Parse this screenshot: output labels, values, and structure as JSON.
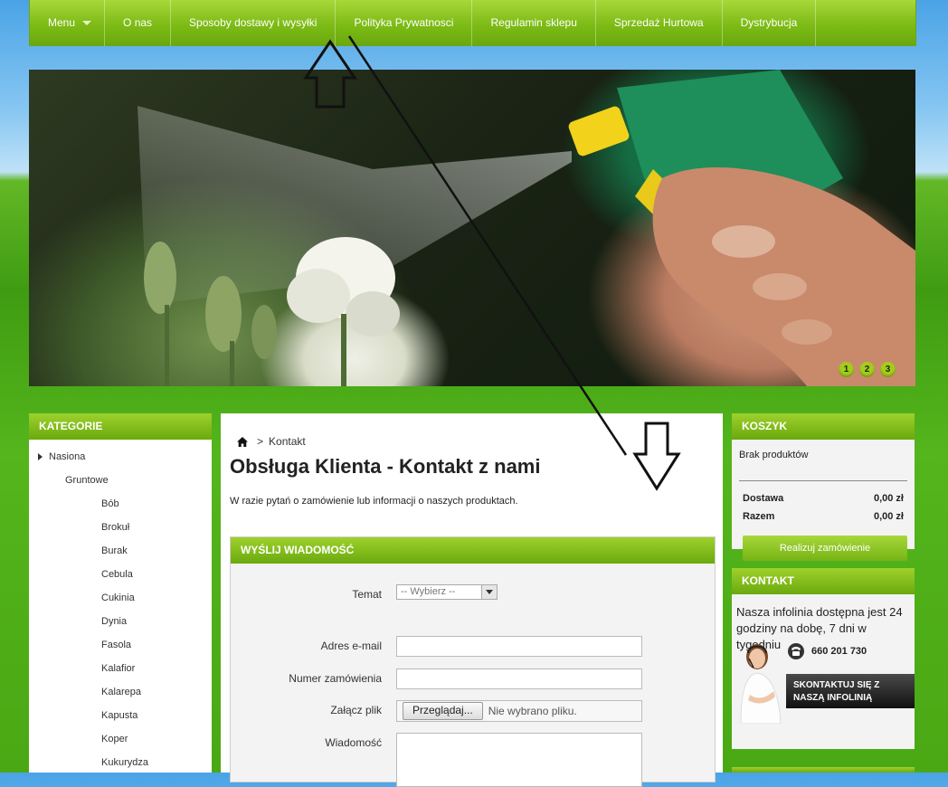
{
  "nav": {
    "items": [
      {
        "label": "Menu",
        "key": "menu"
      },
      {
        "label": "O nas",
        "key": "about"
      },
      {
        "label": "Sposoby dostawy i wysyłki",
        "key": "shipping"
      },
      {
        "label": "Polityka Prywatnosci",
        "key": "privacy"
      },
      {
        "label": "Regulamin sklepu",
        "key": "terms"
      },
      {
        "label": "Sprzedaż Hurtowa",
        "key": "wholesale"
      },
      {
        "label": "Dystrybucja",
        "key": "distribution"
      }
    ]
  },
  "banner": {
    "pages": [
      "1",
      "2",
      "3"
    ]
  },
  "categories": {
    "title": "KATEGORIE",
    "level1": "Nasiona",
    "level2": "Gruntowe",
    "items": [
      "Bób",
      "Brokuł",
      "Burak",
      "Cebula",
      "Cukinia",
      "Dynia",
      "Fasola",
      "Kalafior",
      "Kalarepa",
      "Kapusta",
      "Koper",
      "Kukurydza"
    ]
  },
  "breadcrumb": {
    "separator": ">",
    "current": "Kontakt"
  },
  "main": {
    "title": "Obsługa Klienta - Kontakt z nami",
    "intro": "W razie pytań o zamówienie lub informacji o naszych produktach."
  },
  "form": {
    "title": "WYŚLIJ WIADOMOŚĆ",
    "subject_label": "Temat",
    "subject_value": "-- Wybierz --",
    "email_label": "Adres e-mail",
    "order_label": "Numer zamówienia",
    "file_label": "Załącz plik",
    "file_button": "Przeglądaj...",
    "file_none": "Nie wybrano pliku.",
    "message_label": "Wiadomość"
  },
  "cart": {
    "title": "KOSZYK",
    "empty": "Brak produktów",
    "shipping_label": "Dostawa",
    "shipping_value": "0,00 zł",
    "total_label": "Razem",
    "total_value": "0,00 zł",
    "order_button": "Realizuj zamówienie"
  },
  "contact": {
    "title": "KONTAKT",
    "text": "Nasza infolinia dostępna jest 24 godziny na dobę, 7 dni w tygodniu",
    "phone": "660 201 730",
    "button_line1": "SKONTAKTUJ SIĘ Z",
    "button_line2": "NASZĄ INFOLINIĄ"
  },
  "colors": {
    "accent_green": "#7dbb16",
    "dark_button": "#111111"
  }
}
